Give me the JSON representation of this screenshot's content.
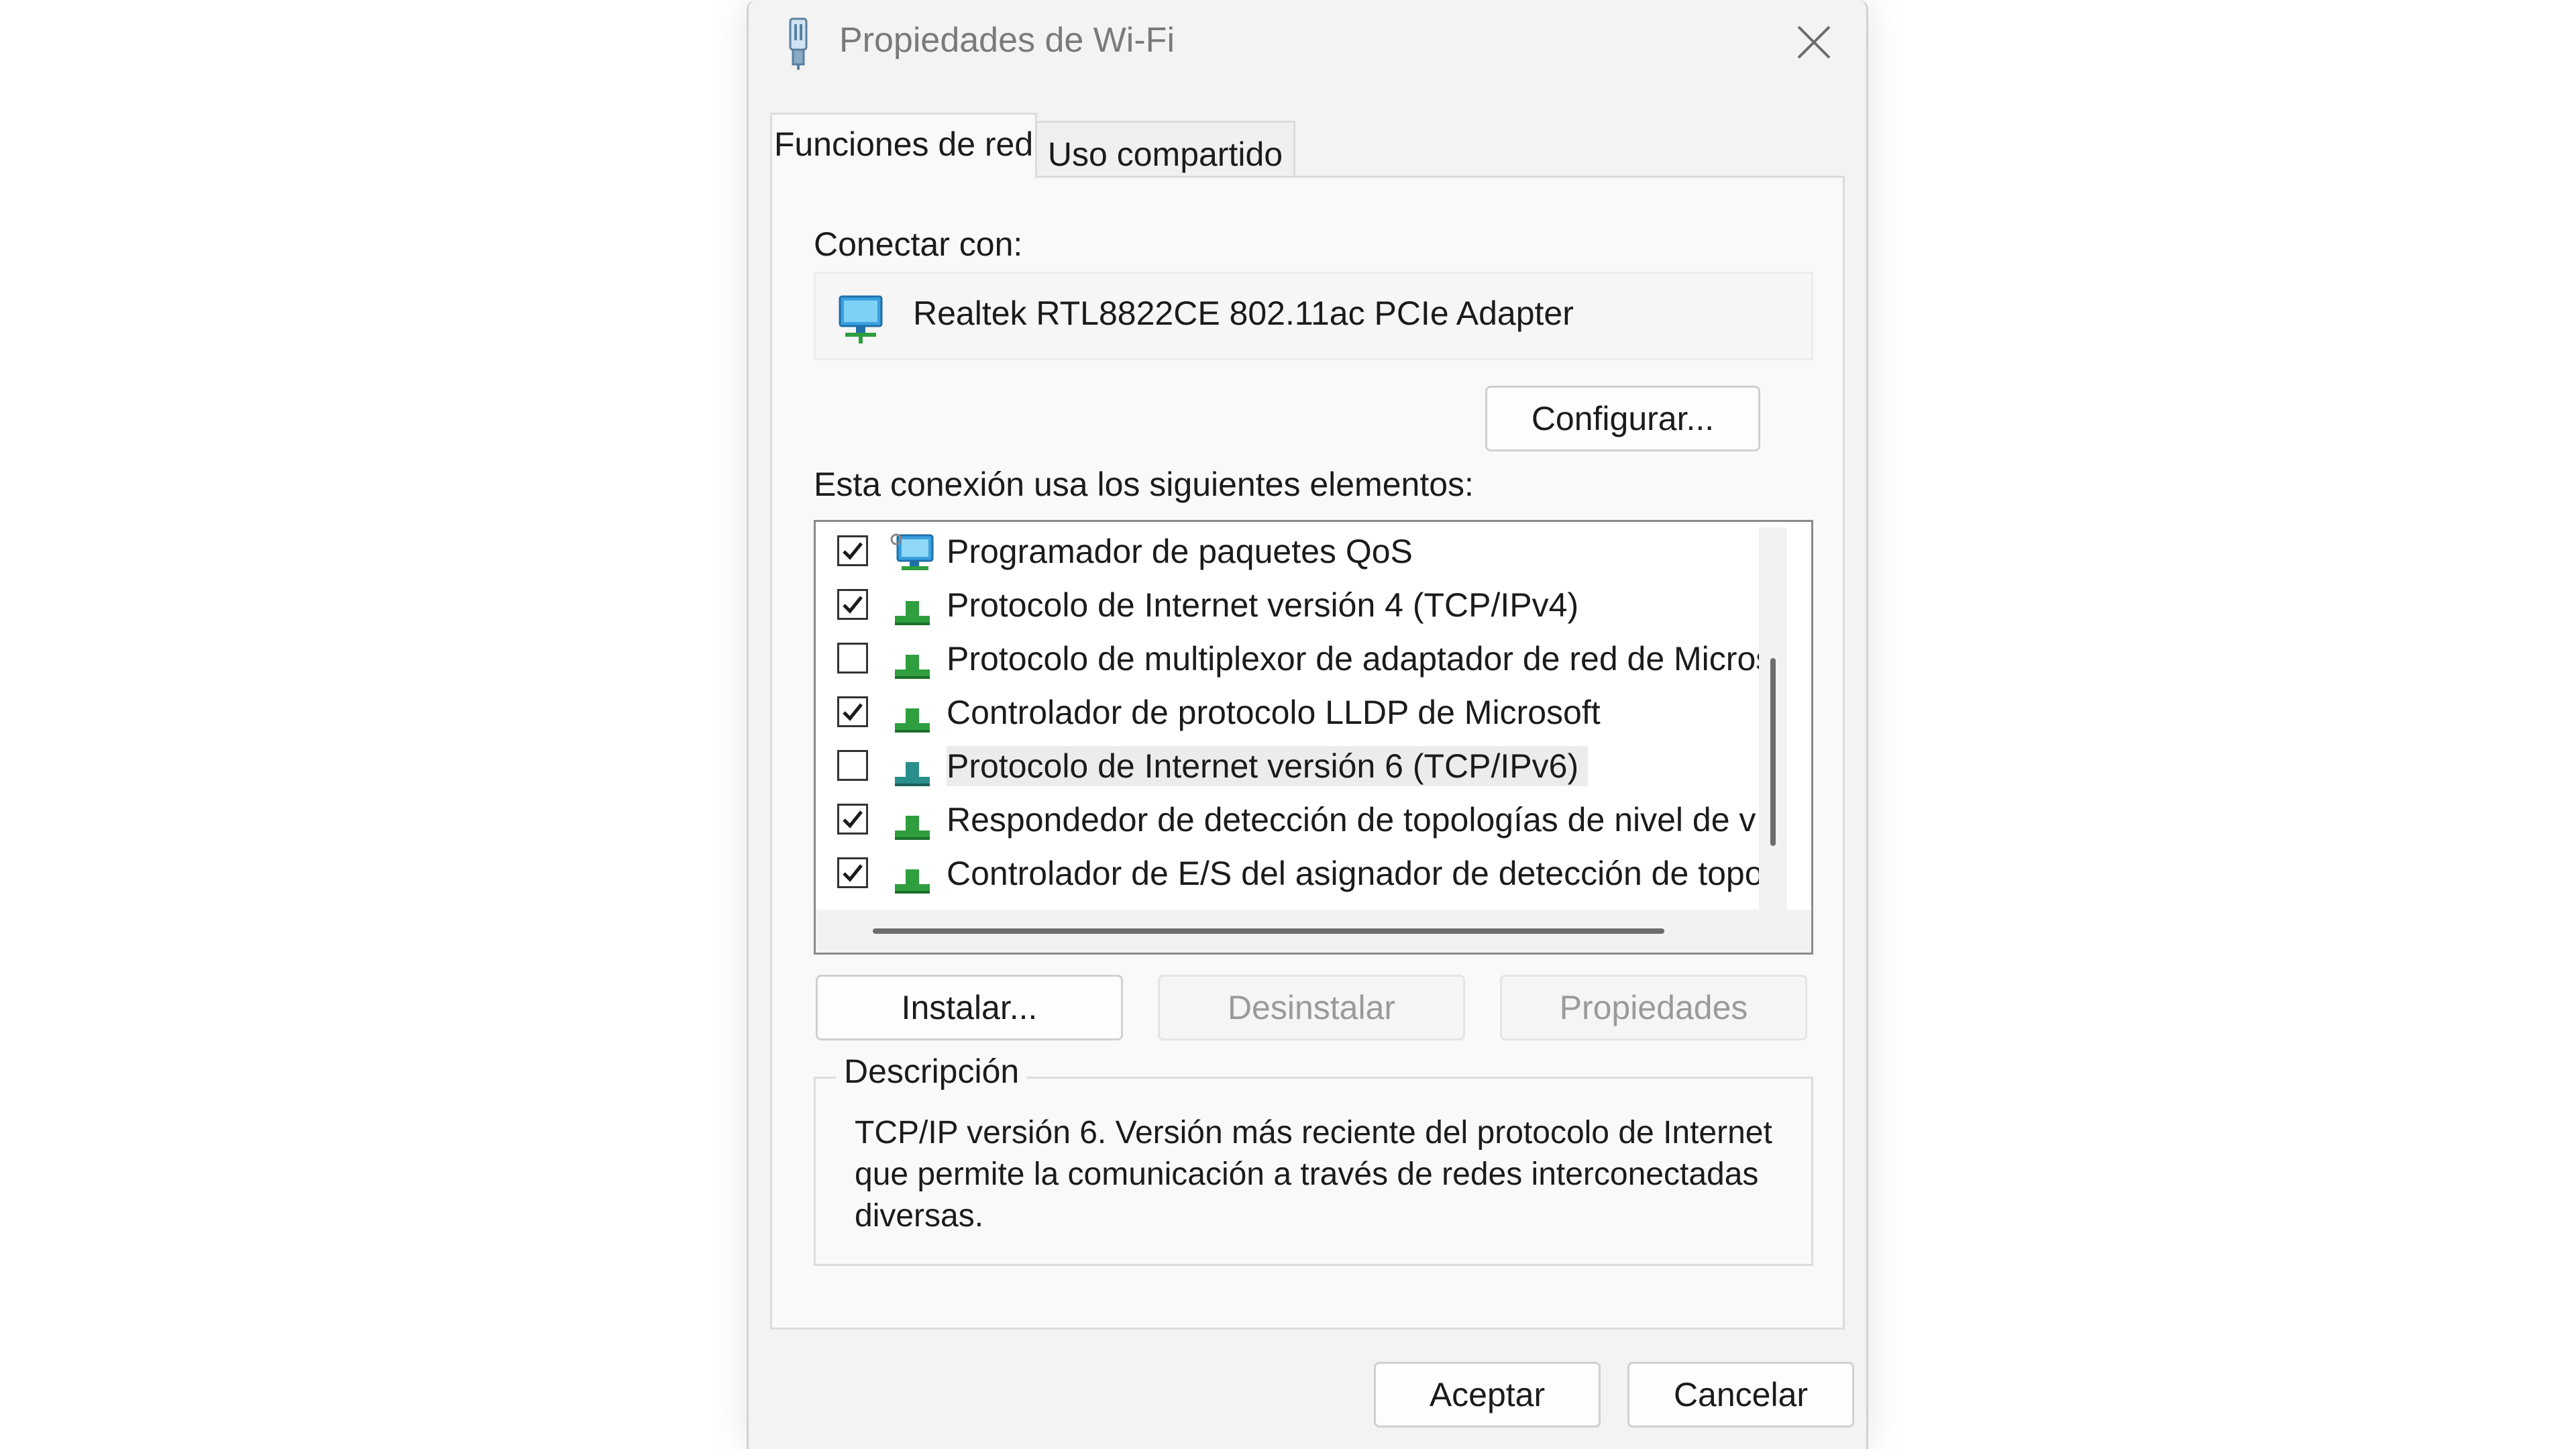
{
  "window": {
    "title": "Propiedades de Wi-Fi"
  },
  "tabs": [
    {
      "label": "Funciones de red",
      "active": true
    },
    {
      "label": "Uso compartido",
      "active": false
    }
  ],
  "connect": {
    "label": "Conectar con:",
    "adapter_name": "Realtek RTL8822CE 802.11ac PCIe Adapter",
    "configure_label": "Configurar..."
  },
  "items_label": "Esta conexión usa los siguientes elementos:",
  "items": [
    {
      "label": "Programador de paquetes QoS",
      "checked": true,
      "icon": "qos-scheduler-icon"
    },
    {
      "label": "Protocolo de Internet versión 4 (TCP/IPv4)",
      "checked": true,
      "icon": "protocol-icon"
    },
    {
      "label": "Protocolo de multiplexor de adaptador de red de Micros",
      "checked": false,
      "icon": "protocol-icon"
    },
    {
      "label": "Controlador de protocolo LLDP de Microsoft",
      "checked": true,
      "icon": "protocol-icon"
    },
    {
      "label": "Protocolo de Internet versión 6 (TCP/IPv6)",
      "checked": false,
      "icon": "protocol-icon",
      "selected": true
    },
    {
      "label": "Respondedor de detección de topologías de nivel de v",
      "checked": true,
      "icon": "protocol-icon"
    },
    {
      "label": "Controlador de E/S del asignador de detección de topo",
      "checked": true,
      "icon": "protocol-icon"
    }
  ],
  "actions": {
    "install": "Instalar...",
    "uninstall": "Desinstalar",
    "properties": "Propiedades"
  },
  "description": {
    "legend": "Descripción",
    "text": "TCP/IP versión 6. Versión más reciente del protocolo de Internet que permite la comunicación a través de redes interconectadas diversas."
  },
  "footer": {
    "ok": "Aceptar",
    "cancel": "Cancelar"
  },
  "colors": {
    "protocol_green": "#2e9e3e",
    "monitor_blue": "#2a8fd6"
  }
}
